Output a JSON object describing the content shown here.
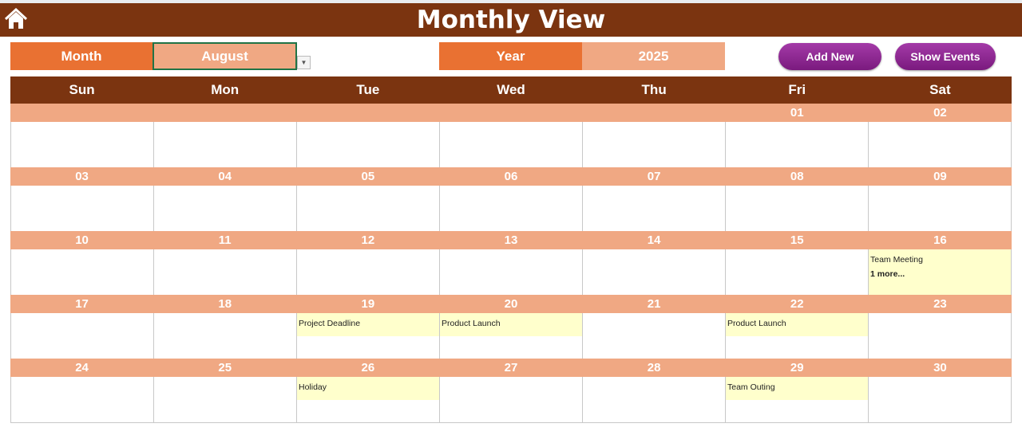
{
  "header": {
    "title": "Monthly View",
    "home_icon": "home-icon"
  },
  "controls": {
    "month_label": "Month",
    "month_value": "August",
    "year_label": "Year",
    "year_value": "2025",
    "add_new": "Add New",
    "show_events": "Show Events"
  },
  "colors": {
    "header": "#7B3410",
    "label": "#E97132",
    "band": "#F0A883",
    "event": "#FFFFCC",
    "button": "#8B2290"
  },
  "weekdays": [
    "Sun",
    "Mon",
    "Tue",
    "Wed",
    "Thu",
    "Fri",
    "Sat"
  ],
  "weeks": [
    {
      "days": [
        {
          "date": ""
        },
        {
          "date": ""
        },
        {
          "date": ""
        },
        {
          "date": ""
        },
        {
          "date": ""
        },
        {
          "date": "01"
        },
        {
          "date": "02"
        }
      ]
    },
    {
      "days": [
        {
          "date": "03"
        },
        {
          "date": "04"
        },
        {
          "date": "05"
        },
        {
          "date": "06"
        },
        {
          "date": "07"
        },
        {
          "date": "08"
        },
        {
          "date": "09"
        }
      ]
    },
    {
      "days": [
        {
          "date": "10"
        },
        {
          "date": "11"
        },
        {
          "date": "12"
        },
        {
          "date": "13"
        },
        {
          "date": "14"
        },
        {
          "date": "15"
        },
        {
          "date": "16",
          "event": "Team Meeting",
          "more": "1 more..."
        }
      ]
    },
    {
      "days": [
        {
          "date": "17"
        },
        {
          "date": "18"
        },
        {
          "date": "19",
          "event": "Project Deadline"
        },
        {
          "date": "20",
          "event": "Product Launch"
        },
        {
          "date": "21"
        },
        {
          "date": "22",
          "event": "Product Launch"
        },
        {
          "date": "23"
        }
      ]
    },
    {
      "days": [
        {
          "date": "24"
        },
        {
          "date": "25"
        },
        {
          "date": "26",
          "event": "Holiday"
        },
        {
          "date": "27"
        },
        {
          "date": "28"
        },
        {
          "date": "29",
          "event": "Team Outing"
        },
        {
          "date": "30"
        }
      ]
    }
  ]
}
